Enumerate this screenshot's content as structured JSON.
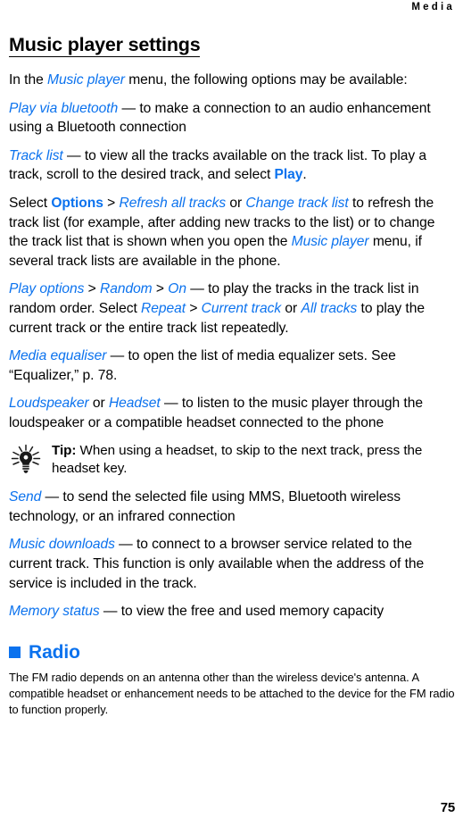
{
  "header": {
    "running_head": "Media"
  },
  "section": {
    "heading": "Music player settings",
    "intro": {
      "pre": "In the ",
      "menu": "Music player",
      "post": " menu, the following options may be available:"
    }
  },
  "options": [
    {
      "name": "Play via bluetooth",
      "dash": " — ",
      "desc": "to make a connection to an audio enhancement using a Bluetooth connection"
    },
    {
      "name": "Track list",
      "dash": " — ",
      "desc": "to view all the tracks available on the track list. To play a track, scroll to the desired track, and select ",
      "command": "Play",
      "tail": "."
    }
  ],
  "paragraph_options": {
    "p1": "Select ",
    "cmd_options": "Options",
    "sep1": " > ",
    "item_refresh": "Refresh all tracks",
    "p2": " or ",
    "item_change": "Change track list",
    "p3": " to refresh the track list (for example, after adding new tracks to the list) or to change the track list that is shown when you open the ",
    "item_music_player": "Music player",
    "p4": " menu, if several track lists are available in the phone."
  },
  "paragraph_play_options": {
    "item_play_options": "Play options",
    "sep1": " > ",
    "item_random": "Random",
    "sep2": " > ",
    "item_on": "On",
    "dash": " — ",
    "t1": "to play the tracks in the track list in random order. Select ",
    "item_repeat": "Repeat",
    "sep3": " > ",
    "item_current_track": "Current track",
    "t2": " or ",
    "item_all_tracks": "All tracks",
    "t3": " to play the current track or the entire track list repeatedly."
  },
  "paragraph_equaliser": {
    "item": "Media equaliser",
    "dash": " — ",
    "text": "to open the list of media equalizer sets. See “Equalizer,” p. 78."
  },
  "paragraph_loudspeaker": {
    "item_loudspeaker": "Loudspeaker",
    "or": " or ",
    "item_headset": "Headset",
    "dash": " — ",
    "text": "to listen to the music player through the loudspeaker or a compatible headset connected to the phone"
  },
  "tip": {
    "icon": "lightbulb-icon",
    "label": "Tip:",
    "text": " When using a headset, to skip to the next track, press the headset key."
  },
  "paragraph_send": {
    "item": "Send",
    "dash": " — ",
    "text": "to send the selected file using MMS, Bluetooth wireless technology, or an infrared connection"
  },
  "paragraph_music_downloads": {
    "item": "Music downloads",
    "dash": " — ",
    "text": "to connect to a browser service related to the current track. This function is only available when the address of the service is included in the track."
  },
  "paragraph_memory_status": {
    "item": "Memory status",
    "dash": " — ",
    "text": "to view the free and used memory capacity"
  },
  "radio": {
    "heading": "Radio",
    "bullet": "square-bullet",
    "note": "The FM radio depends on an antenna other than the wireless device's antenna. A compatible headset or enhancement needs to be attached to the device for the FM radio to function properly."
  },
  "footer": {
    "page_number": "75"
  },
  "colors": {
    "accent_blue": "#0B72EE",
    "text_black": "#000000",
    "background": "#FFFFFF"
  }
}
